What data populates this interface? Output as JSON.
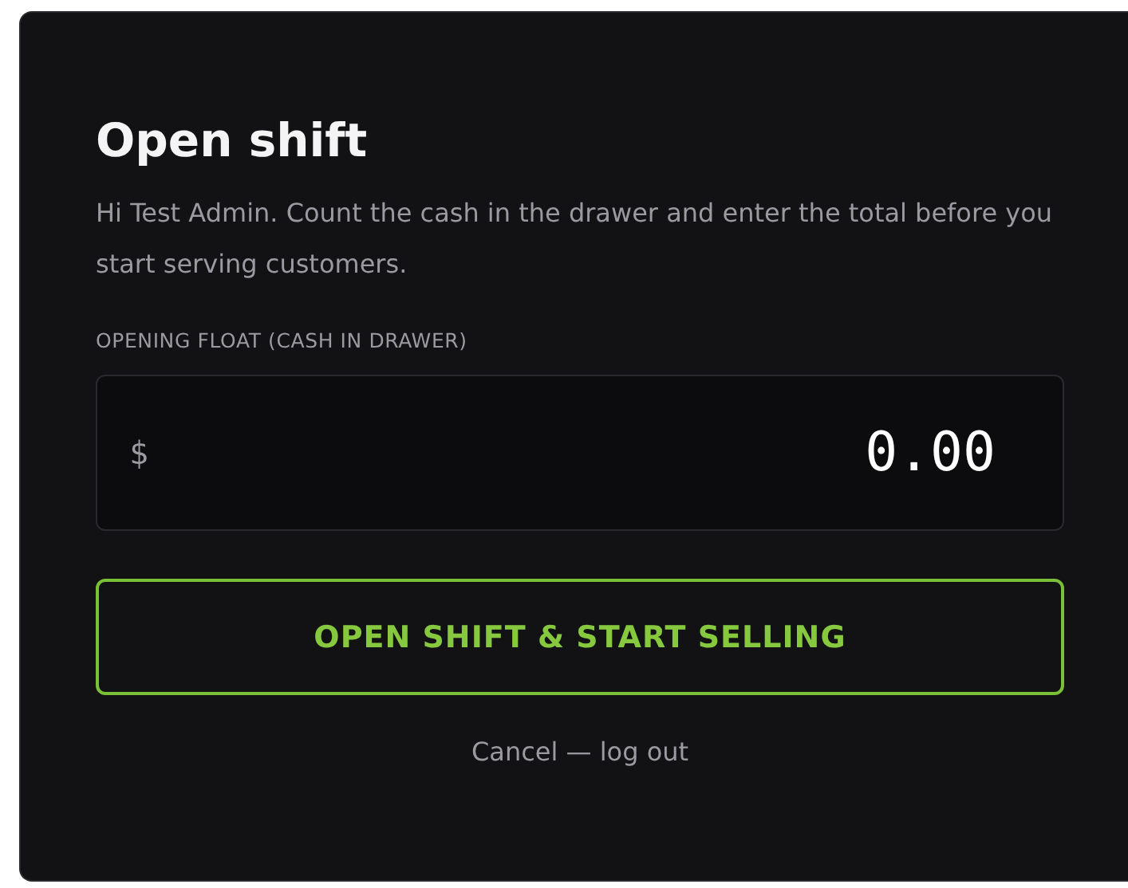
{
  "dialog": {
    "title": "Open shift",
    "message": "Hi Test Admin. Count the cash in the drawer and enter the total before you start serving customers.",
    "field": {
      "label": "OPENING FLOAT (CASH IN DRAWER)",
      "prefix": "$",
      "value": "0.00"
    },
    "primary_button": "OPEN SHIFT & START SELLING",
    "cancel_link": "Cancel — log out"
  }
}
